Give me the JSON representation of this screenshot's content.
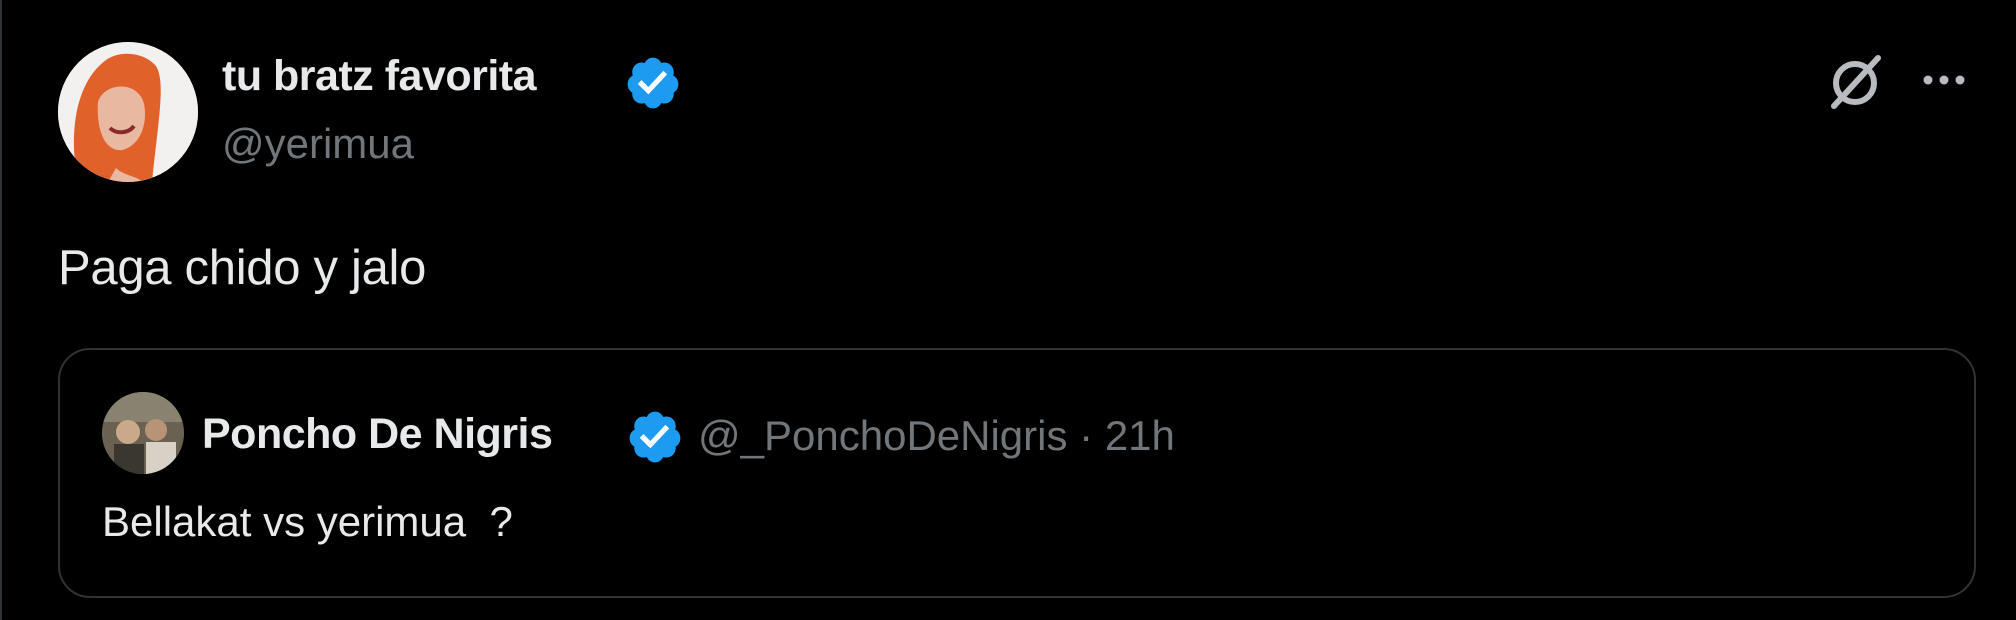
{
  "tweet": {
    "author": {
      "display_name": "tu bratz favorita",
      "handle": "@yerimua",
      "verified": true,
      "avatar_icon": "profile-avatar"
    },
    "text": "Paga chido y jalo",
    "actions": {
      "grok_icon": "grok-icon",
      "more_icon": "more-options-icon"
    },
    "quoted": {
      "display_name": "Poncho De Nigris",
      "handle": "@_PonchoDeNigris",
      "separator": "·",
      "timestamp": "21h",
      "verified": true,
      "text": "Bellakat vs yerimua  ?"
    }
  },
  "colors": {
    "background": "#000000",
    "primary_text": "#e7e9ea",
    "secondary_text": "#71767b",
    "border": "#2f3336",
    "verified_blue": "#1d9bf0"
  }
}
